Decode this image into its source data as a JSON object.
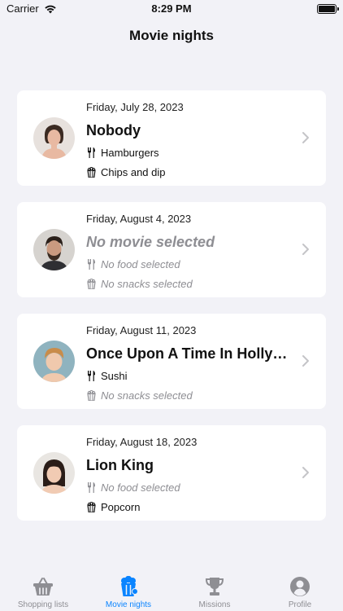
{
  "status": {
    "carrier": "Carrier",
    "time": "8:29 PM"
  },
  "nav": {
    "title": "Movie nights"
  },
  "cards": [
    {
      "date": "Friday, July 28, 2023",
      "movie": "Nobody",
      "food": "Hamburgers",
      "snack": "Chips and dip"
    },
    {
      "date": "Friday, August 4, 2023",
      "movie": "No movie selected",
      "food": "No food selected",
      "snack": "No snacks selected"
    },
    {
      "date": "Friday, August 11, 2023",
      "movie": "Once Upon A Time In Hollywo...",
      "food": "Sushi",
      "snack": "No snacks selected"
    },
    {
      "date": "Friday, August 18, 2023",
      "movie": "Lion King",
      "food": "No food selected",
      "snack": "Popcorn"
    }
  ],
  "tabs": [
    {
      "label": "Shopping lists",
      "icon": "basket-icon"
    },
    {
      "label": "Movie nights",
      "icon": "popcorn-icon"
    },
    {
      "label": "Missions",
      "icon": "trophy-icon"
    },
    {
      "label": "Profile",
      "icon": "profile-icon"
    }
  ],
  "colors": {
    "accent": "#0a84ff",
    "background": "#f2f2f7",
    "muted": "#8e8e93"
  }
}
